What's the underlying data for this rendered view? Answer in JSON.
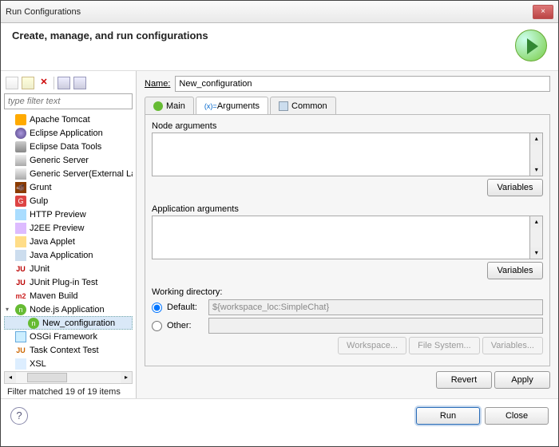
{
  "window": {
    "title": "Run Configurations",
    "close": "×"
  },
  "header": {
    "title": "Create, manage, and run configurations"
  },
  "left": {
    "filter_placeholder": "type filter text",
    "tree": [
      {
        "label": "Apache Tomcat",
        "ico": "tomcat"
      },
      {
        "label": "Eclipse Application",
        "ico": "eclipse"
      },
      {
        "label": "Eclipse Data Tools",
        "ico": "db"
      },
      {
        "label": "Generic Server",
        "ico": "srv"
      },
      {
        "label": "Generic Server(External Launch)",
        "ico": "srv"
      },
      {
        "label": "Grunt",
        "ico": "grunt",
        "badge": "🐗"
      },
      {
        "label": "Gulp",
        "ico": "gulp",
        "badge": "G"
      },
      {
        "label": "HTTP Preview",
        "ico": "http"
      },
      {
        "label": "J2EE Preview",
        "ico": "j2ee"
      },
      {
        "label": "Java Applet",
        "ico": "applet"
      },
      {
        "label": "Java Application",
        "ico": "java"
      },
      {
        "label": "JUnit",
        "ico": "junit",
        "badge": "JU"
      },
      {
        "label": "JUnit Plug-in Test",
        "ico": "junit",
        "badge": "JU"
      },
      {
        "label": "Maven Build",
        "ico": "m2",
        "badge": "m2"
      },
      {
        "label": "Node.js Application",
        "ico": "node",
        "badge": "n",
        "expanded": true
      },
      {
        "label": "New_configuration",
        "ico": "node",
        "badge": "n",
        "child": true,
        "selected": true
      },
      {
        "label": "OSGi Framework",
        "ico": "osgi"
      },
      {
        "label": "Task Context Test",
        "ico": "task",
        "badge": "JU"
      },
      {
        "label": "XSL",
        "ico": "xsl"
      }
    ],
    "status": "Filter matched 19 of 19 items"
  },
  "right": {
    "name_label": "Name:",
    "name_value": "New_configuration",
    "tabs": {
      "main": "Main",
      "arguments": "Arguments",
      "common": "Common"
    },
    "node_args_label": "Node arguments",
    "node_args_value": "",
    "app_args_label": "Application arguments",
    "app_args_value": "",
    "variables_btn": "Variables",
    "wd_label": "Working directory:",
    "wd_default": "Default:",
    "wd_default_value": "${workspace_loc:SimpleChat}",
    "wd_other": "Other:",
    "wd_other_value": "",
    "workspace_btn": "Workspace...",
    "filesystem_btn": "File System...",
    "variables2_btn": "Variables...",
    "revert": "Revert",
    "apply": "Apply"
  },
  "footer": {
    "help": "?",
    "run": "Run",
    "close": "Close"
  }
}
